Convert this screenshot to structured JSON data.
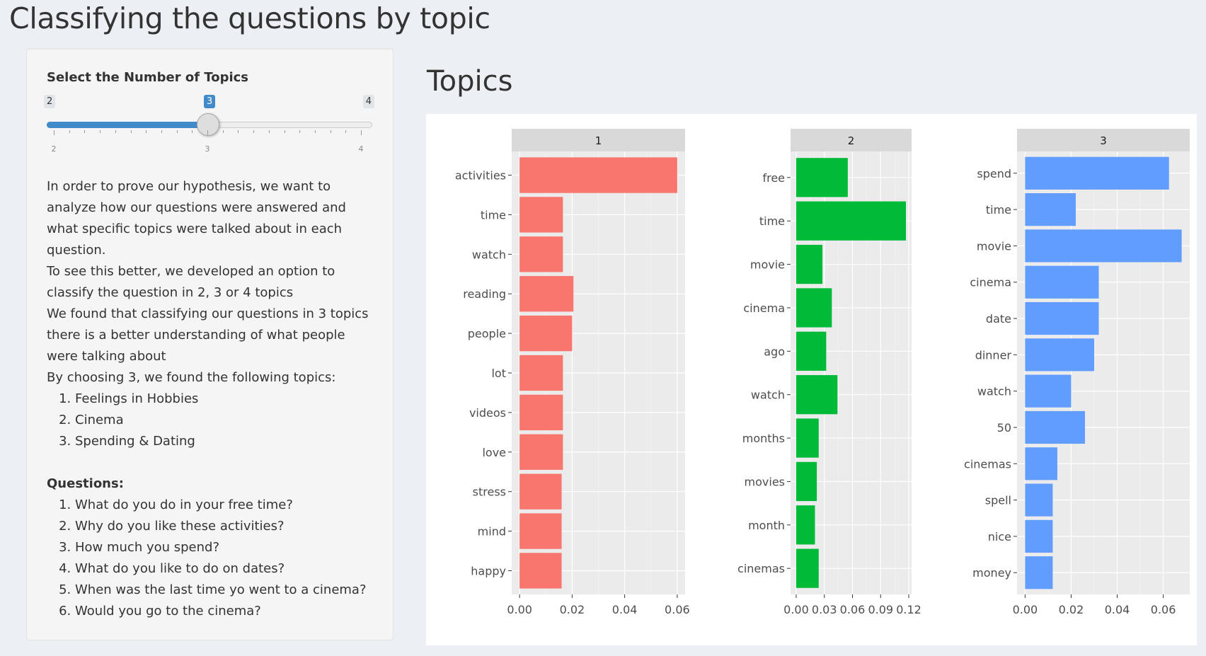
{
  "page": {
    "title": "Classifying the questions by topic"
  },
  "sidebar": {
    "slider": {
      "label": "Select the Number of Topics",
      "min": 2,
      "max": 4,
      "value": 3,
      "min_label": "2",
      "max_label": "4",
      "value_label": "3",
      "grid_labels": [
        "2",
        "3",
        "4"
      ],
      "bar_color": "#428bca"
    },
    "intro": [
      "In order to prove our hypothesis, we want to analyze how our questions were answered and what specific topics were talked about in each question.",
      "To see this better, we developed an option to classify the question in 2, 3 or 4 topics",
      "We found that classifying our questions in 3 topics there is a better understanding of what people were talking about",
      "By choosing 3, we found the following topics:"
    ],
    "topics_list": [
      "Feelings in Hobbies",
      "Cinema",
      "Spending & Dating"
    ],
    "questions_heading": "Questions:",
    "questions": [
      "What do you do in your free time?",
      "Why do you like these activities?",
      "How much you spend?",
      "What do you like to do on dates?",
      "When was the last time yo went to a cinema?",
      "Would you go to the cinema?"
    ]
  },
  "main": {
    "title": "Topics"
  },
  "chart_data": [
    {
      "type": "bar",
      "orientation": "horizontal",
      "facet": "1",
      "color": "#F8766D",
      "categories": [
        "activities",
        "time",
        "watch",
        "reading",
        "people",
        "lot",
        "videos",
        "love",
        "stress",
        "mind",
        "happy"
      ],
      "values": [
        0.06,
        0.0165,
        0.0165,
        0.0205,
        0.02,
        0.0165,
        0.0165,
        0.0165,
        0.016,
        0.016,
        0.016
      ],
      "xlim": [
        -0.003,
        0.063
      ],
      "ticks": [
        0,
        0.02,
        0.04,
        0.06
      ],
      "tick_labels": [
        "0.00",
        "0.02",
        "0.04",
        "0.06"
      ]
    },
    {
      "type": "bar",
      "orientation": "horizontal",
      "facet": "2",
      "color": "#00BA38",
      "categories": [
        "free",
        "time",
        "movie",
        "cinema",
        "ago",
        "watch",
        "months",
        "movies",
        "month",
        "cinemas"
      ],
      "values": [
        0.055,
        0.117,
        0.028,
        0.038,
        0.032,
        0.044,
        0.024,
        0.022,
        0.02,
        0.024
      ],
      "xlim": [
        -0.006,
        0.123
      ],
      "ticks": [
        0,
        0.03,
        0.06,
        0.09,
        0.12
      ],
      "tick_labels": [
        "0.00",
        "0.03",
        "0.06",
        "0.09",
        "0.12"
      ]
    },
    {
      "type": "bar",
      "orientation": "horizontal",
      "facet": "3",
      "color": "#619CFF",
      "categories": [
        "spend",
        "time",
        "movie",
        "cinema",
        "date",
        "dinner",
        "watch",
        "50",
        "cinemas",
        "spell",
        "nice",
        "money"
      ],
      "values": [
        0.0625,
        0.022,
        0.068,
        0.032,
        0.032,
        0.03,
        0.02,
        0.026,
        0.014,
        0.012,
        0.012,
        0.012
      ],
      "xlim": [
        -0.0035,
        0.0715
      ],
      "ticks": [
        0,
        0.02,
        0.04,
        0.06
      ],
      "tick_labels": [
        "0.00",
        "0.02",
        "0.04",
        "0.06"
      ]
    }
  ]
}
